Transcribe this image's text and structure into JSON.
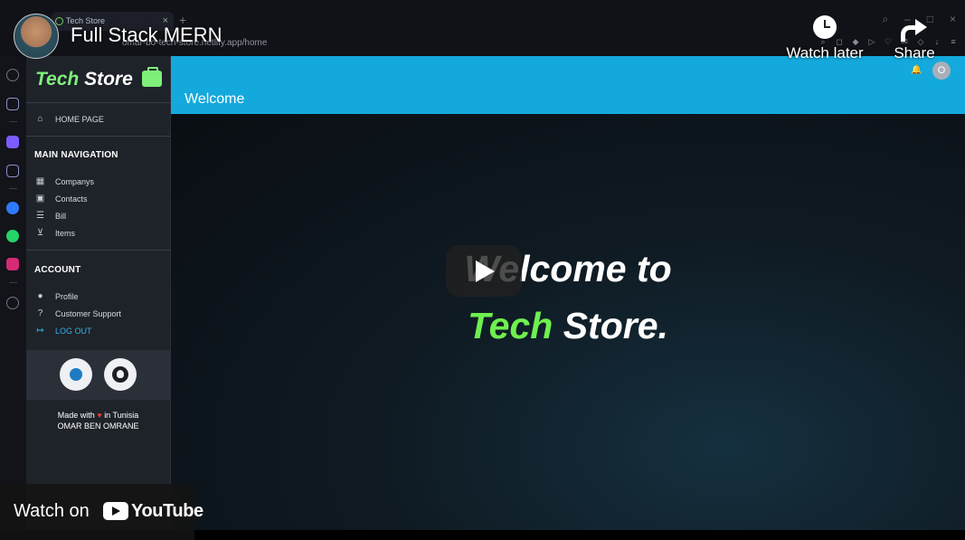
{
  "browser": {
    "tab_title": "Tech Store",
    "new_tab": "+",
    "tab_close": "×",
    "url": "omar-bo-tech-store.netlify.app/home"
  },
  "app": {
    "brand_first": "Tech",
    "brand_second": "Store",
    "home_label": "HOME PAGE",
    "main_navigation": "MAIN NAVIGATION",
    "nav_items": [
      "Companys",
      "Contacts",
      "Bill",
      "Items"
    ],
    "account": "ACCOUNT",
    "account_items": [
      "Profile",
      "Customer Support",
      "LOG OUT"
    ],
    "made_with": "Made with",
    "made_in": "in Tunisia",
    "author": "OMAR BEN OMRANE",
    "header_title": "Welcome",
    "avatar_initial": "O",
    "hero_line1": "Welcome to",
    "hero_tech": "Tech",
    "hero_store": "Store."
  },
  "youtube": {
    "video_title": "Full Stack MERN",
    "watch_later": "Watch later",
    "share": "Share",
    "watch_on": "Watch on",
    "youtube_word": "YouTube"
  },
  "colors": {
    "header": "#14a9dd",
    "brand_green": "#7ef07a",
    "hero_green": "#6ff04f",
    "sidebar": "#1e2229",
    "logout": "#32b4e8"
  }
}
